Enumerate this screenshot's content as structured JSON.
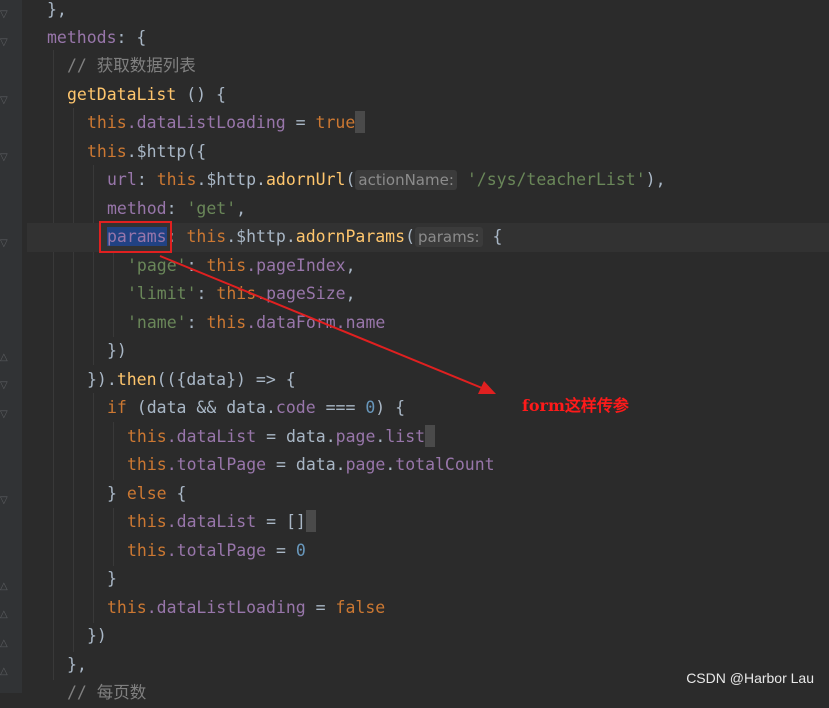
{
  "code": {
    "l0": "},",
    "l1_kw": "methods",
    "l1_rest": ": {",
    "l2": "// 获取数据列表",
    "l3_fn": "getDataList",
    "l3_rest": " () {",
    "l4_this": "this",
    "l4_prop": ".dataListLoading",
    "l4_eq": " = ",
    "l4_val": "true",
    "l5_this": "this",
    "l5_rest": ".$http({",
    "l6_key": "url",
    "l6_colon": ": ",
    "l6_this": "this",
    "l6_mid": ".$http.",
    "l6_fn": "adornUrl",
    "l6_paren": "(",
    "l6_hint": "actionName:",
    "l6_str": "'/sys/teacherList'",
    "l6_end": "),",
    "l7_key": "method",
    "l7_colon": ": ",
    "l7_str": "'get'",
    "l7_end": ",",
    "l8_key": "params",
    "l8_colon": ": ",
    "l8_this": "this",
    "l8_mid": ".$http.",
    "l8_fn": "adornParams",
    "l8_paren": "(",
    "l8_hint": "params:",
    "l8_end": " {",
    "l9_str": "'page'",
    "l9_colon": ": ",
    "l9_this": "this",
    "l9_prop": ".pageIndex",
    "l9_end": ",",
    "l10_str": "'limit'",
    "l10_colon": ": ",
    "l10_this": "this",
    "l10_prop": ".pageSize",
    "l10_end": ",",
    "l11_str": "'name'",
    "l11_colon": ": ",
    "l11_this": "this",
    "l11_prop": ".dataForm.name",
    "l12": "})",
    "l13_a": "}).",
    "l13_fn": "then",
    "l13_b": "(({data}) => {",
    "l14_kw": "if",
    "l14_a": " (data && data.",
    "l14_prop": "code",
    "l14_b": " === ",
    "l14_num": "0",
    "l14_c": ") {",
    "l15_this": "this",
    "l15_prop": ".dataList",
    "l15_a": " = data.",
    "l15_prop2": "page",
    "l15_b": ".",
    "l15_prop3": "list",
    "l16_this": "this",
    "l16_prop": ".totalPage",
    "l16_a": " = data.",
    "l16_prop2": "page",
    "l16_b": ".",
    "l16_prop3": "totalCount",
    "l17_a": "} ",
    "l17_kw": "else",
    "l17_b": " {",
    "l18_this": "this",
    "l18_prop": ".dataList",
    "l18_a": " = ",
    "l18_b": "[]",
    "l19_this": "this",
    "l19_prop": ".totalPage",
    "l19_a": " = ",
    "l19_num": "0",
    "l20": "}",
    "l21_this": "this",
    "l21_prop": ".dataListLoading",
    "l21_a": " = ",
    "l21_val": "false",
    "l22": "})",
    "l23": "},",
    "l24": "// 每页数"
  },
  "annotation": "form这样传参",
  "watermark": "CSDN @Harbor Lau",
  "colors": {
    "background": "#2b2b2b",
    "keyword": "#cc7832",
    "property": "#9876aa",
    "function": "#ffc66d",
    "string": "#6a8759",
    "number": "#6897bb",
    "comment": "#808080",
    "annotation_red": "#e02020"
  }
}
